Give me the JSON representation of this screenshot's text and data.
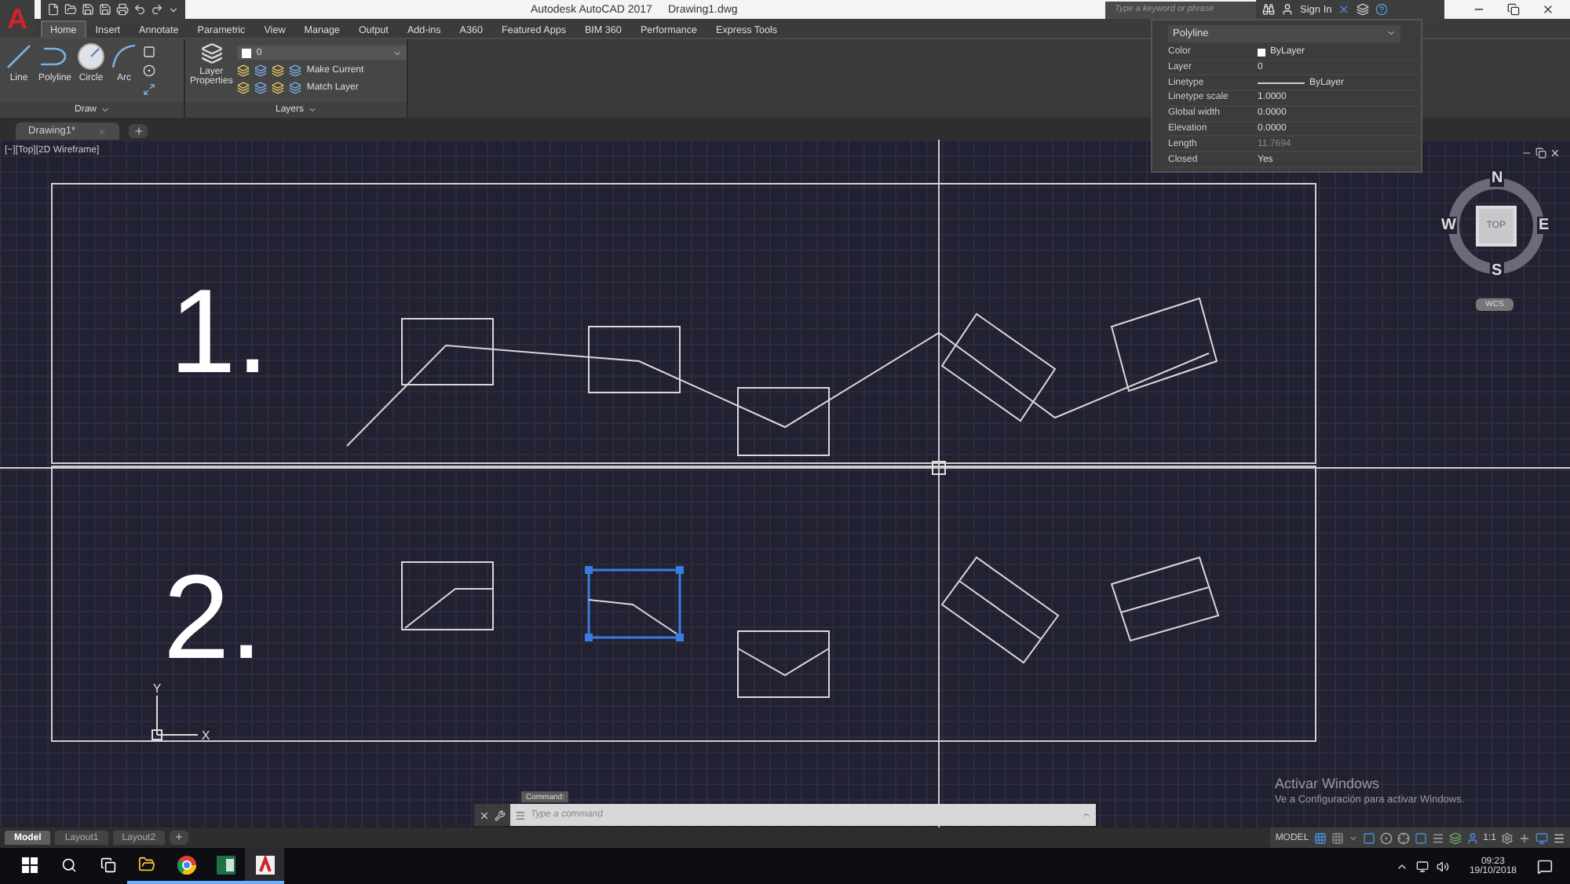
{
  "app_button": {
    "letter": "A"
  },
  "title_bar": {
    "app_name": "Autodesk AutoCAD 2017",
    "document": "Drawing1.dwg",
    "search": {
      "placeholder": "Type a keyword or phrase"
    },
    "sign_in": "Sign In"
  },
  "ribbon_tabs": [
    {
      "label": "Home",
      "selected": true
    },
    {
      "label": "Insert",
      "selected": false
    },
    {
      "label": "Annotate",
      "selected": false
    },
    {
      "label": "Parametric",
      "selected": false
    },
    {
      "label": "View",
      "selected": false
    },
    {
      "label": "Manage",
      "selected": false
    },
    {
      "label": "Output",
      "selected": false
    },
    {
      "label": "Add-ins",
      "selected": false
    },
    {
      "label": "A360",
      "selected": false
    },
    {
      "label": "Featured Apps",
      "selected": false
    },
    {
      "label": "BIM 360",
      "selected": false
    },
    {
      "label": "Performance",
      "selected": false
    },
    {
      "label": "Express Tools",
      "selected": false
    }
  ],
  "draw_panel": {
    "title": "Draw",
    "tools": [
      {
        "label": "Line",
        "kind": "line"
      },
      {
        "label": "Polyline",
        "kind": "polyline"
      },
      {
        "label": "Circle",
        "kind": "circle"
      },
      {
        "label": "Arc",
        "kind": "arc"
      }
    ]
  },
  "layers_panel": {
    "title": "Layers",
    "properties_button": "Layer Properties",
    "layer_value": "0",
    "actions": [
      "Make Current",
      "Match Layer"
    ]
  },
  "file_tabs": [
    {
      "label": "Drawing1*",
      "selected": true
    }
  ],
  "viewport_label": "[−][Top][2D Wireframe]",
  "drawing": {
    "rows": [
      {
        "label": "1.",
        "kind": "joined",
        "shapes": [
          {
            "selected": false
          },
          {
            "selected": false
          },
          {
            "selected": false
          },
          {
            "selected": false
          },
          {
            "selected": false
          }
        ]
      },
      {
        "label": "2.",
        "kind": "separate",
        "shapes": [
          {
            "selected": false
          },
          {
            "selected": true
          },
          {
            "selected": false
          },
          {
            "selected": false
          },
          {
            "selected": false
          }
        ]
      }
    ],
    "axes": {
      "x": "X",
      "y": "Y"
    }
  },
  "viewcube": {
    "face": "TOP",
    "north": "N",
    "south": "S",
    "east": "E",
    "west": "W",
    "coordinate_system": "WCS"
  },
  "properties": {
    "object_type": "Polyline",
    "rows": [
      {
        "label": "Color",
        "value": "ByLayer",
        "kind": "color",
        "readonly": false
      },
      {
        "label": "Layer",
        "value": "0",
        "kind": "text",
        "readonly": false
      },
      {
        "label": "Linetype",
        "value": "ByLayer",
        "kind": "linetype",
        "readonly": false
      },
      {
        "label": "Linetype scale",
        "value": "1.0000",
        "kind": "text",
        "readonly": false
      },
      {
        "label": "Global width",
        "value": "0.0000",
        "kind": "text",
        "readonly": false
      },
      {
        "label": "Elevation",
        "value": "0.0000",
        "kind": "text",
        "readonly": false
      },
      {
        "label": "Length",
        "value": "11.7694",
        "kind": "text",
        "readonly": true
      },
      {
        "label": "Closed",
        "value": "Yes",
        "kind": "text",
        "readonly": false
      }
    ]
  },
  "command_line": {
    "tooltip": "Command:",
    "placeholder": "Type a command"
  },
  "activation": {
    "title": "Activar Windows",
    "message": "Ve a Configuración para activar Windows."
  },
  "layout_tabs": [
    {
      "label": "Model",
      "selected": true
    },
    {
      "label": "Layout1",
      "selected": false
    },
    {
      "label": "Layout2",
      "selected": false
    }
  ],
  "status_bar": {
    "model": "MODEL",
    "scale": "1:1"
  },
  "taskbar": {
    "time": "09:23",
    "date": "19/10/2018"
  }
}
